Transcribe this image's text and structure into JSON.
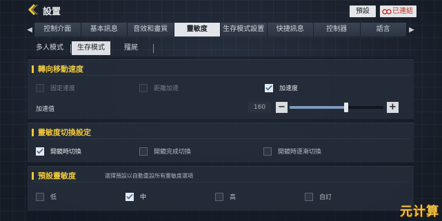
{
  "header": {
    "title": "設置",
    "preset_label": "預設",
    "sync_label": "已連結"
  },
  "tabs": [
    {
      "label": "控制介面"
    },
    {
      "label": "基本訊息"
    },
    {
      "label": "音效和畫質"
    },
    {
      "label": "靈敏度",
      "active": true
    },
    {
      "label": "生存模式設置"
    },
    {
      "label": "快捷訊息"
    },
    {
      "label": "控制器"
    },
    {
      "label": "語言"
    }
  ],
  "subtabs": [
    {
      "label": "多人模式"
    },
    {
      "label": "生存模式",
      "active": true
    },
    {
      "label": "殭屍"
    }
  ],
  "turn_speed": {
    "title": "轉向移動速度",
    "options": [
      {
        "label": "固定速度",
        "checked": false
      },
      {
        "label": "距離加速",
        "checked": false
      },
      {
        "label": "加速度",
        "checked": true
      }
    ],
    "accel_label": "加速值",
    "accel_value": "160",
    "accel_fraction": 0.6
  },
  "sensitivity_switch": {
    "title": "靈敏度切換設定",
    "options": [
      {
        "label": "開鏡時切換",
        "checked": true
      },
      {
        "label": "開鏡完成切換",
        "checked": false
      },
      {
        "label": "開鏡時逐漸切換",
        "checked": false
      }
    ]
  },
  "preset_sensitivity": {
    "title": "預設靈敏度",
    "note": "選擇預設以自動重設所有靈敏度選項",
    "options": [
      {
        "label": "低",
        "checked": false
      },
      {
        "label": "中",
        "checked": true
      },
      {
        "label": "高",
        "checked": false
      },
      {
        "label": "自訂",
        "checked": false
      }
    ]
  },
  "watermark": "元计算",
  "colors": {
    "accent": "#f0c83a",
    "sync_red": "#c63127",
    "active_tab": "#e3e5e8"
  }
}
